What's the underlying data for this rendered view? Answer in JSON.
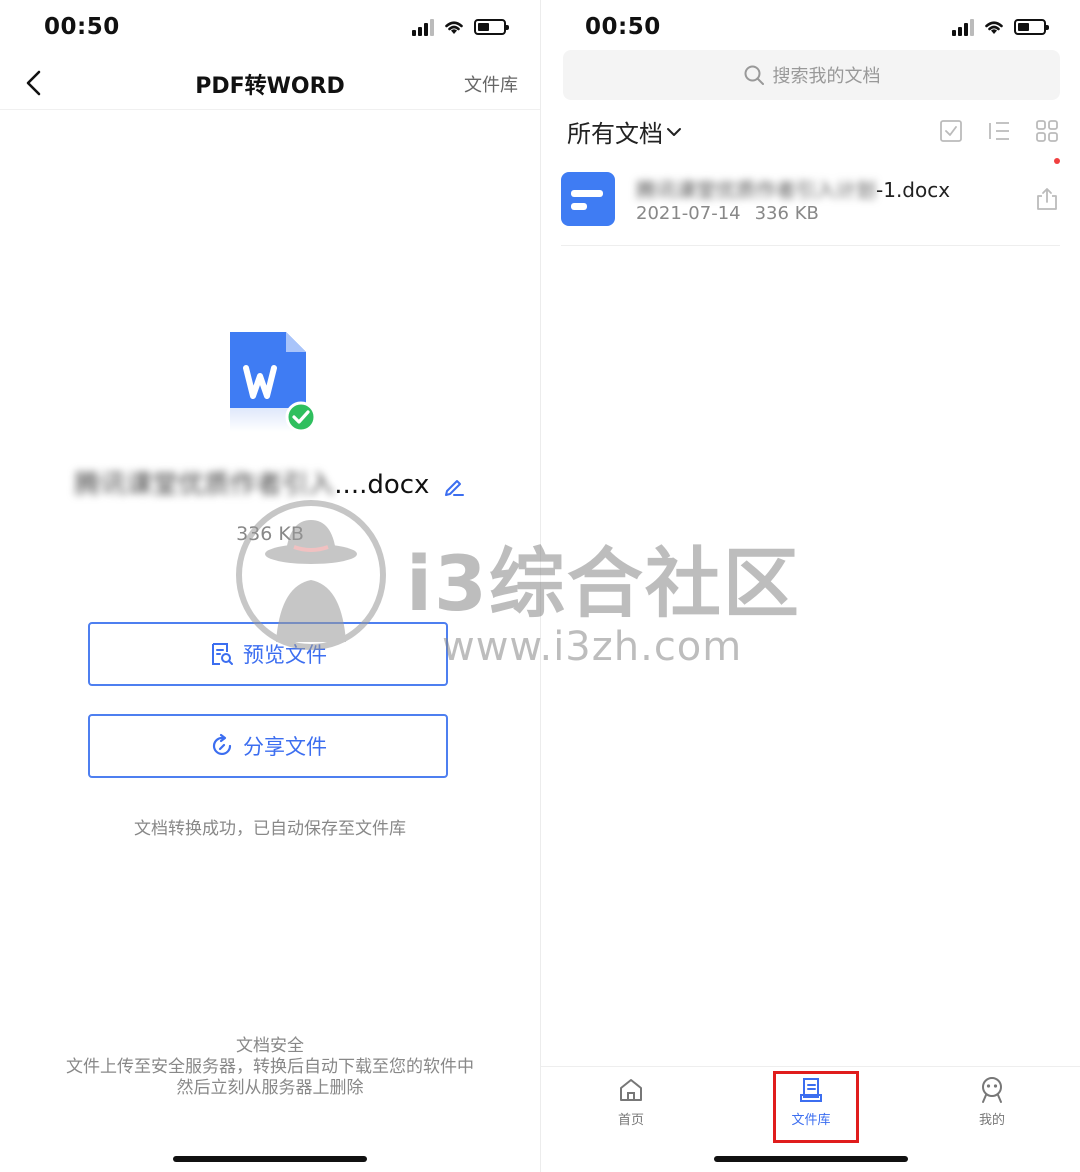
{
  "left_screen": {
    "status": {
      "time": "00:50"
    },
    "nav": {
      "title": "PDF转WORD",
      "right_link": "文件库"
    },
    "file": {
      "name_blurred": "腾讯课堂优质作者引入",
      "name_suffix": "....docx",
      "size": "336 KB"
    },
    "buttons": {
      "preview": "预览文件",
      "share": "分享文件"
    },
    "success_note": "文档转换成功，已自动保存至文件库",
    "security": {
      "title": "文档安全",
      "line1": "文件上传至安全服务器，转换后自动下载至您的软件中",
      "line2": "然后立刻从服务器上删除"
    }
  },
  "right_screen": {
    "status": {
      "time": "00:50"
    },
    "search": {
      "placeholder": "搜索我的文档"
    },
    "filter": {
      "label": "所有文档"
    },
    "documents": [
      {
        "name_blurred": "腾讯课堂优质作者引入计划",
        "name_suffix": "-1.docx",
        "date": "2021-07-14",
        "size": "336 KB"
      }
    ],
    "tabs": [
      {
        "label": "首页",
        "icon": "home-icon",
        "active": false
      },
      {
        "label": "文件库",
        "icon": "file-library-icon",
        "active": true
      },
      {
        "label": "我的",
        "icon": "profile-icon",
        "active": false
      }
    ]
  },
  "watermark": {
    "text": "i3综合社区",
    "url": "www.i3zh.com"
  },
  "colors": {
    "accent": "#3c6ef0",
    "highlight": "#e01c1c",
    "doc_blue": "#3f7cf3",
    "success_green": "#2fbf5e"
  }
}
